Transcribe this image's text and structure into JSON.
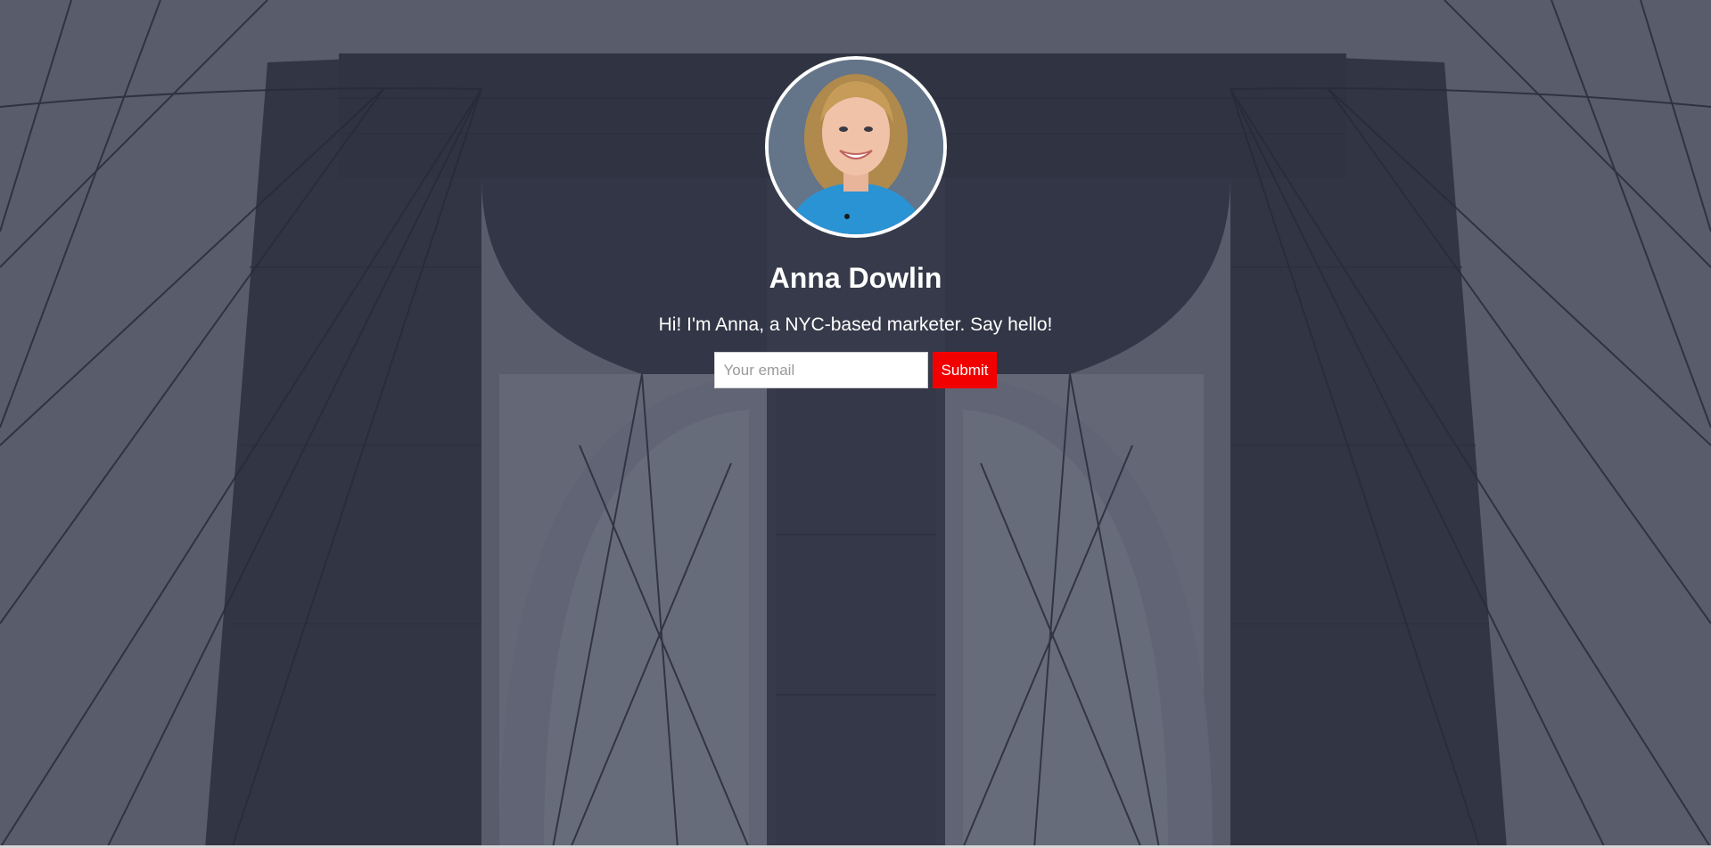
{
  "profile": {
    "name": "Anna Dowlin",
    "tagline": "Hi! I'm Anna, a NYC-based marketer. Say hello!"
  },
  "form": {
    "email_placeholder": "Your email",
    "submit_label": "Submit"
  },
  "colors": {
    "accent": "#f20000",
    "text": "#ffffff",
    "background_tint": "#4a4d5a"
  },
  "icons": {
    "background": "bridge-background-image",
    "avatar": "profile-photo"
  }
}
